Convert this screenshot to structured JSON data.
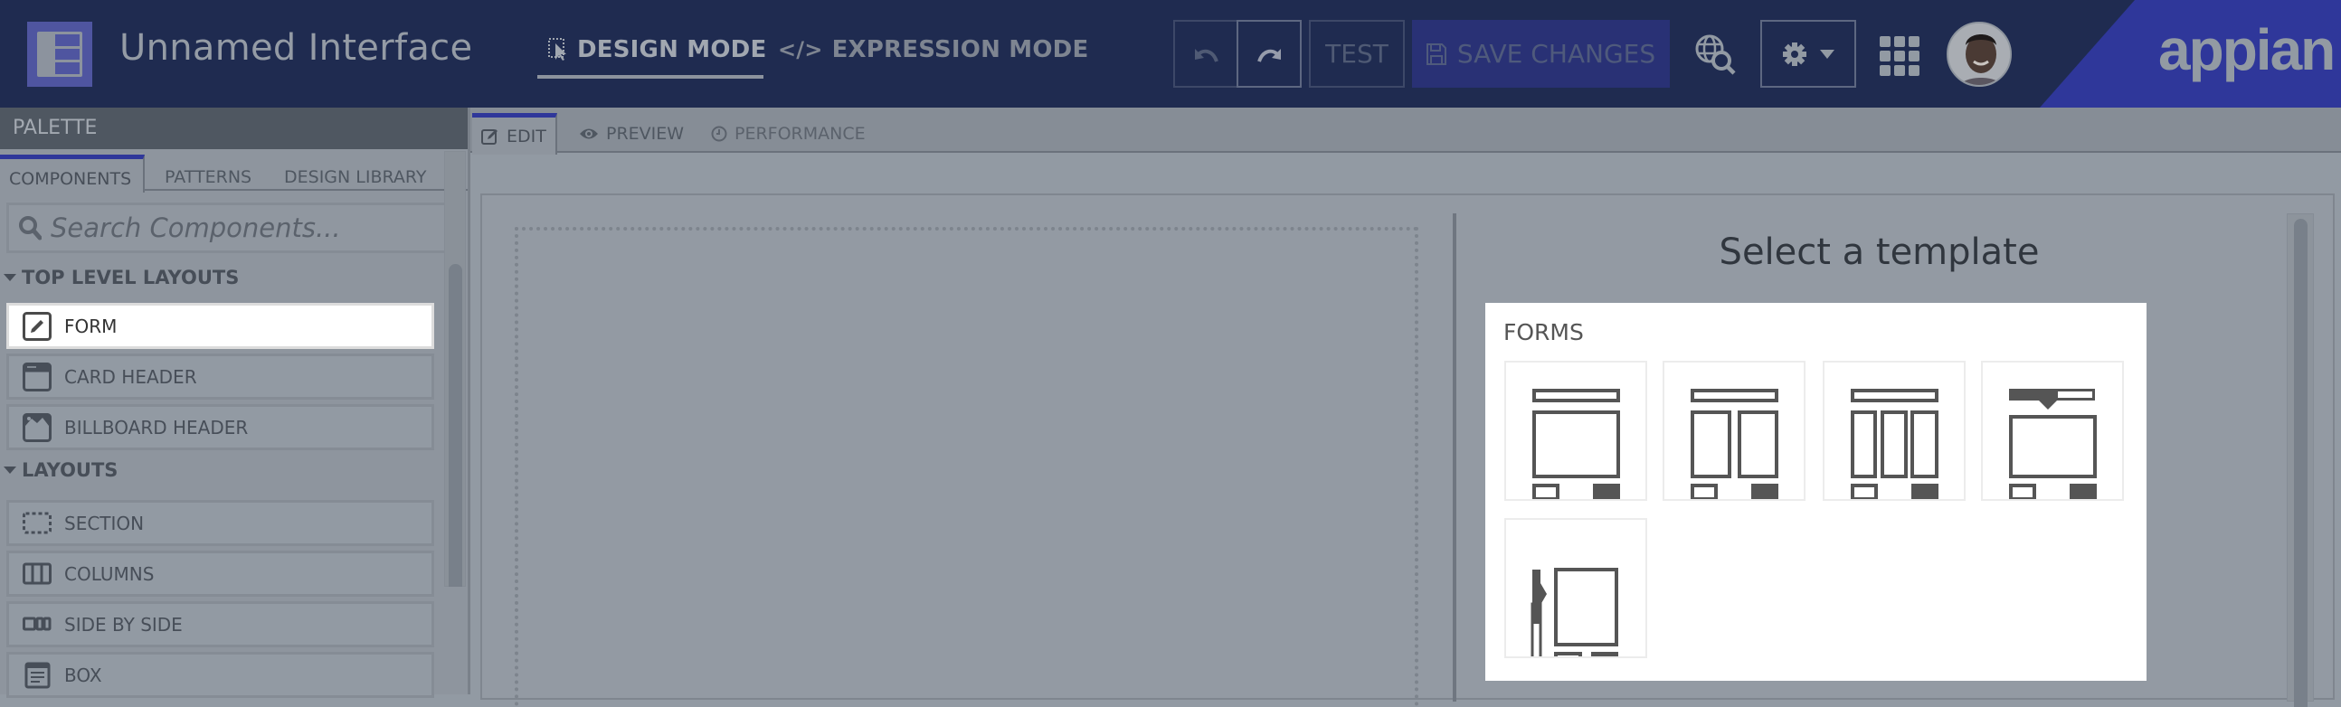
{
  "header": {
    "title": "Unnamed Interface",
    "modes": [
      {
        "label": "DESIGN MODE",
        "icon": "design-cursor-icon",
        "active": true
      },
      {
        "label": "EXPRESSION MODE",
        "icon": "code-icon",
        "active": false
      }
    ],
    "buttons": {
      "undo_icon": "undo-icon",
      "redo_icon": "redo-icon",
      "test_label": "TEST",
      "save_label": "SAVE CHANGES",
      "save_icon": "floppy-disk-icon",
      "settings_icon": "gear-icon"
    },
    "logo_text": "appian",
    "colors": {
      "background": "#1f2b50",
      "accent": "#2f379a"
    }
  },
  "palette": {
    "title": "PALETTE",
    "tabs": [
      {
        "label": "COMPONENTS",
        "active": true
      },
      {
        "label": "PATTERNS",
        "active": false
      },
      {
        "label": "DESIGN LIBRARY",
        "active": false
      }
    ],
    "search_placeholder": "Search Components...",
    "sections": [
      {
        "title": "TOP LEVEL LAYOUTS",
        "items": [
          {
            "label": "FORM",
            "icon": "form-pencil-icon",
            "selected": true
          },
          {
            "label": "CARD HEADER",
            "icon": "card-header-icon",
            "selected": false
          },
          {
            "label": "BILLBOARD HEADER",
            "icon": "billboard-header-icon",
            "selected": false
          }
        ]
      },
      {
        "title": "LAYOUTS",
        "items": [
          {
            "label": "SECTION",
            "icon": "section-icon",
            "selected": false
          },
          {
            "label": "COLUMNS",
            "icon": "columns-icon",
            "selected": false
          },
          {
            "label": "SIDE BY SIDE",
            "icon": "side-by-side-icon",
            "selected": false
          },
          {
            "label": "BOX",
            "icon": "box-icon",
            "selected": false
          }
        ]
      }
    ]
  },
  "canvas": {
    "tabs": [
      {
        "label": "EDIT",
        "icon": "edit-icon",
        "active": true
      },
      {
        "label": "PREVIEW",
        "icon": "eye-icon",
        "active": false
      },
      {
        "label": "PERFORMANCE",
        "icon": "clock-icon",
        "active": false
      }
    ],
    "template_panel": {
      "title": "Select a template",
      "group_label": "FORMS",
      "templates": [
        {
          "name": "one-column-form"
        },
        {
          "name": "two-column-form"
        },
        {
          "name": "three-column-form"
        },
        {
          "name": "wizard-form"
        },
        {
          "name": "sidebar-wizard-form"
        }
      ]
    }
  }
}
